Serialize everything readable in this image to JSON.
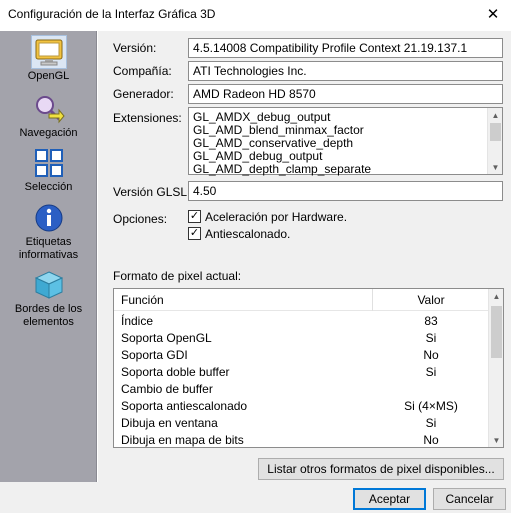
{
  "window": {
    "title": "Configuración de la Interfaz Gráfica 3D"
  },
  "sidebar": {
    "items": [
      {
        "label": "OpenGL",
        "icon": "monitor-icon"
      },
      {
        "label": "Navegación",
        "icon": "magnifier-arrow-icon"
      },
      {
        "label": "Selección",
        "icon": "grid-select-icon"
      },
      {
        "label": "Etiquetas informativas",
        "icon": "info-icon"
      },
      {
        "label": "Bordes de los elementos",
        "icon": "cube-icon"
      }
    ]
  },
  "info": {
    "version_label": "Versión:",
    "version_value": "4.5.14008 Compatibility Profile Context 21.19.137.1",
    "company_label": "Compañía:",
    "company_value": "ATI Technologies Inc.",
    "generator_label": "Generador:",
    "generator_value": "AMD Radeon HD 8570",
    "extensions_label": "Extensiones:",
    "extensions": [
      "GL_AMDX_debug_output",
      "GL_AMD_blend_minmax_factor",
      "GL_AMD_conservative_depth",
      "GL_AMD_debug_output",
      "GL_AMD_depth_clamp_separate"
    ],
    "glsl_label": "Versión GLSL:",
    "glsl_value": "4.50",
    "options_label": "Opciones:",
    "option_hw": "Aceleración por Hardware.",
    "option_aa": "Antiescalonado."
  },
  "pixel_format": {
    "title": "Formato de pixel actual:",
    "col_function": "Función",
    "col_value": "Valor",
    "rows": [
      {
        "fn": "Índice",
        "val": "83"
      },
      {
        "fn": "Soporta OpenGL",
        "val": "Si"
      },
      {
        "fn": "Soporta GDI",
        "val": "No"
      },
      {
        "fn": "Soporta doble buffer",
        "val": "Si"
      },
      {
        "fn": "Cambio de buffer",
        "val": ""
      },
      {
        "fn": "Soporta antiescalonado",
        "val": "Si (4×MS)"
      },
      {
        "fn": "Dibuja en ventana",
        "val": "Si"
      },
      {
        "fn": "Dibuja en mapa de bits",
        "val": "No"
      }
    ],
    "list_button": "Listar otros formatos de pixel disponibles..."
  },
  "footer": {
    "ok": "Aceptar",
    "cancel": "Cancelar"
  },
  "colors": {
    "sidebar_bg": "#a3a3ab",
    "accent": "#0078d7"
  }
}
